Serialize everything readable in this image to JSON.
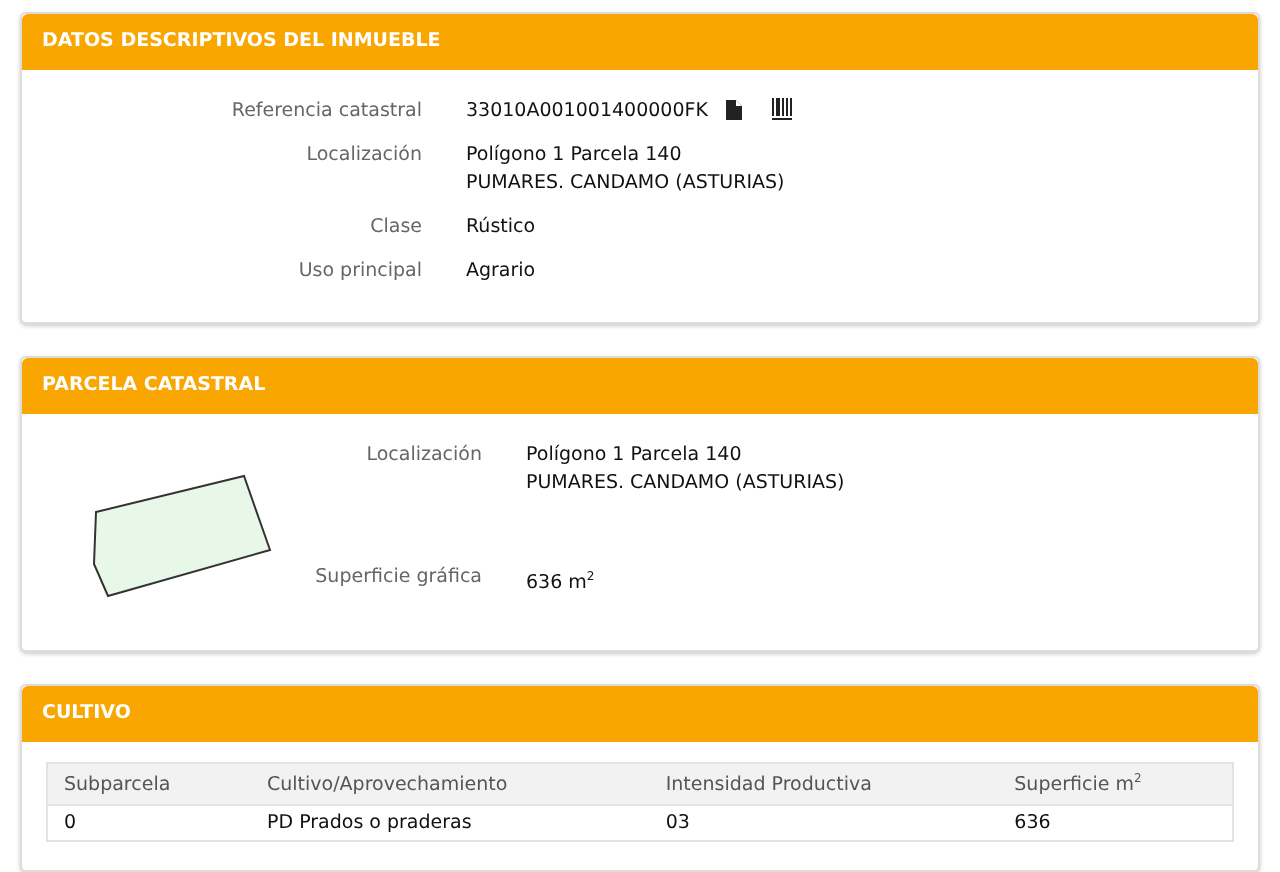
{
  "sections": [
    {
      "title": "DATOS DESCRIPTIVOS DEL INMUEBLE",
      "kind": "fields",
      "fields": [
        {
          "label": "Referencia catastral",
          "lines": [
            "33010A001001400000FK"
          ],
          "kind": "reference"
        },
        {
          "label": "Localización",
          "lines": [
            "Polígono 1 Parcela 140",
            "PUMARES. CANDAMO (ASTURIAS)"
          ],
          "kind": "text"
        },
        {
          "label": "Clase",
          "lines": [
            "Rústico"
          ],
          "kind": "text"
        },
        {
          "label": "Uso principal",
          "lines": [
            "Agrario"
          ],
          "kind": "text"
        }
      ]
    },
    {
      "title": "PARCELA CATASTRAL",
      "kind": "parcel",
      "fields": [
        {
          "label": "Localización",
          "lines": [
            "Polígono 1 Parcela 140",
            "PUMARES. CANDAMO (ASTURIAS)"
          ],
          "kind": "text"
        },
        {
          "label": "Superficie gráfica",
          "lines": [
            "636 m$^{2}$"
          ],
          "kind": "text"
        }
      ]
    },
    {
      "title": "CULTIVO",
      "kind": "table",
      "table": {
        "columns": [
          "Subparcela",
          "Cultivo/Aprovechamiento",
          "Intensidad Productiva",
          "Superficie m$^{2}$"
        ],
        "rows": [
          [
            "0",
            "PD Prados o praderas",
            "03",
            "636"
          ]
        ]
      }
    }
  ]
}
